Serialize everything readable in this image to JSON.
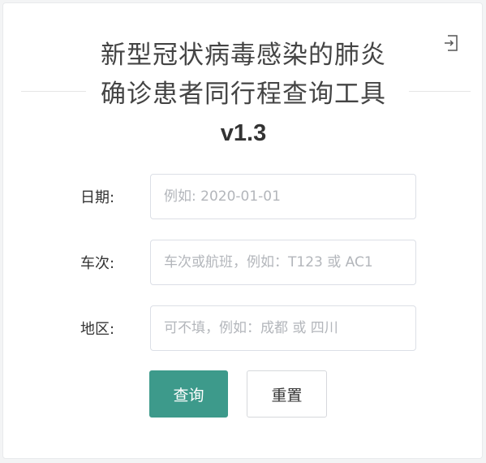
{
  "header": {
    "title_line1": "新型冠状病毒感染的肺炎",
    "title_line2": "确诊患者同行程查询工具",
    "version": "v1.3",
    "exit_icon": "exit-icon"
  },
  "form": {
    "date": {
      "label": "日期:",
      "value": "",
      "placeholder": "例如: 2020-01-01"
    },
    "trip": {
      "label": "车次:",
      "value": "",
      "placeholder": "车次或航班，例如：T123 或 AC1"
    },
    "region": {
      "label": "地区:",
      "value": "",
      "placeholder": "可不填，例如：成都 或 四川"
    }
  },
  "buttons": {
    "query_label": "查询",
    "reset_label": "重置"
  },
  "colors": {
    "accent": "#3d9a8b",
    "title_text": "#444444",
    "placeholder": "#b3b6bb"
  }
}
